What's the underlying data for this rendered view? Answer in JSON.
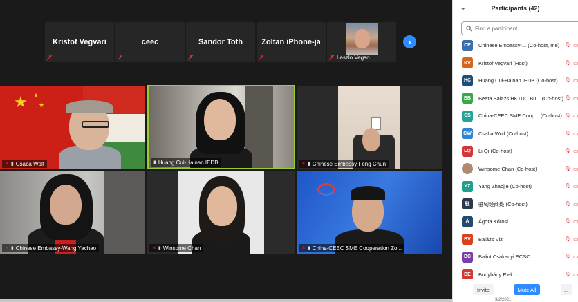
{
  "top_strip": [
    {
      "name": "Kristof Vegvari",
      "type": "name"
    },
    {
      "name": "ceec",
      "type": "name"
    },
    {
      "name": "Sandor Toth",
      "type": "name"
    },
    {
      "name": "Zoltan iPhone-ja",
      "type": "name"
    },
    {
      "name": "Laszlo Vegso",
      "type": "photo"
    }
  ],
  "grid": [
    {
      "label": "Csaba Wolf"
    },
    {
      "label": "Huang Cui-Hainan IEDB"
    },
    {
      "label": "Chinese Embassy   Feng Chun"
    },
    {
      "label": "Chinese Embassy-Wang Yachao"
    },
    {
      "label": "Winsome Chan"
    },
    {
      "label": "China-CEEC SME Cooperation Zo..."
    }
  ],
  "panel": {
    "title": "Participants (42)",
    "search_placeholder": "Find a participant",
    "participants": [
      {
        "initials": "CE",
        "name": "Chinese Embassy-...  (Co-host, me)",
        "color": "#3a6fb0"
      },
      {
        "initials": "KV",
        "name": "Kristof Vegvari (Host)",
        "color": "#d9651c"
      },
      {
        "initials": "HC",
        "name": "Huang Cui-Hainan IEDB (Co-host)",
        "color": "#1f4e79"
      },
      {
        "initials": "BB",
        "name": "Beata Balazs HKTDC Bu...  (Co-host)",
        "color": "#3aa84a"
      },
      {
        "initials": "CS",
        "name": "China-CEEC SME Coop...  (Co-host)",
        "color": "#23a39a"
      },
      {
        "initials": "CW",
        "name": "Csaba Wolf (Co-host)",
        "color": "#2f86d6"
      },
      {
        "initials": "LQ",
        "name": "Li Qi (Co-host)",
        "color": "#d33838"
      },
      {
        "initials": "",
        "name": "Winsome Chan (Co-host)",
        "color": "#b08a70"
      },
      {
        "initials": "YZ",
        "name": "Yang Zhaojie (Co-host)",
        "color": "#20a08a"
      },
      {
        "initials": "驻",
        "name": "驻匈经商处 (Co-host)",
        "color": "#2b3a4a"
      },
      {
        "initials": "Á",
        "name": "Ágota Kőrösi",
        "color": "#244a6e"
      },
      {
        "initials": "BV",
        "name": "Balázs Vizi",
        "color": "#d9401c"
      },
      {
        "initials": "BC",
        "name": "Balint Csakanyi ECSC",
        "color": "#7a3ea8"
      },
      {
        "initials": "BE",
        "name": "Bonyhády Elek",
        "color": "#d33838"
      }
    ],
    "invite_label": "Invite",
    "mute_all_label": "Mute All",
    "more_label": "..."
  },
  "footer": {
    "date": "3/2/2021"
  },
  "icons": {
    "next": "chevron-right-icon",
    "collapse": "chevron-down-icon",
    "search": "search-icon"
  }
}
